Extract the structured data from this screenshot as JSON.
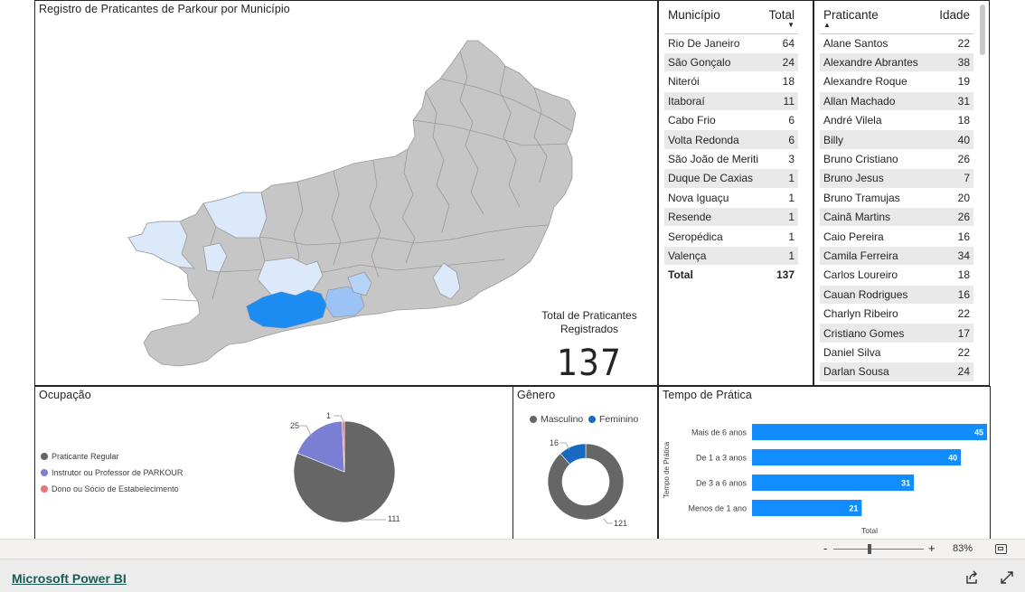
{
  "map": {
    "title": "Registro de Praticantes de Parkour por Município",
    "kpi_label": "Total de Praticantes Registrados",
    "kpi_value": "137"
  },
  "municipios": {
    "headers": [
      "Município",
      "Total"
    ],
    "rows": [
      [
        "Rio De Janeiro",
        "64"
      ],
      [
        "São Gonçalo",
        "24"
      ],
      [
        "Niterói",
        "18"
      ],
      [
        "Itaboraí",
        "11"
      ],
      [
        "Cabo Frio",
        "6"
      ],
      [
        "Volta Redonda",
        "6"
      ],
      [
        "São João de Meriti",
        "3"
      ],
      [
        "Duque De Caxias",
        "1"
      ],
      [
        "Nova Iguaçu",
        "1"
      ],
      [
        "Resende",
        "1"
      ],
      [
        "Seropédica",
        "1"
      ],
      [
        "Valença",
        "1"
      ]
    ],
    "total_label": "Total",
    "total_value": "137"
  },
  "praticantes": {
    "headers": [
      "Praticante",
      "Idade"
    ],
    "rows": [
      [
        "Alane Santos",
        "22"
      ],
      [
        "Alexandre Abrantes",
        "38"
      ],
      [
        "Alexandre Roque",
        "19"
      ],
      [
        "Allan Machado",
        "31"
      ],
      [
        "André Vilela",
        "18"
      ],
      [
        "Billy",
        "40"
      ],
      [
        "Bruno Cristiano",
        "26"
      ],
      [
        "Bruno Jesus",
        "7"
      ],
      [
        "Bruno Tramujas",
        "20"
      ],
      [
        "Cainã Martins",
        "26"
      ],
      [
        "Caio Pereira",
        "16"
      ],
      [
        "Camila Ferreira",
        "34"
      ],
      [
        "Carlos Loureiro",
        "18"
      ],
      [
        "Cauan Rodrigues",
        "16"
      ],
      [
        "Charlyn Ribeiro",
        "22"
      ],
      [
        "Cristiano Gomes",
        "17"
      ],
      [
        "Daniel Silva",
        "22"
      ],
      [
        "Darlan Sousa",
        "24"
      ]
    ]
  },
  "ocupacao": {
    "title": "Ocupação",
    "legend": [
      "Praticante Regular",
      "Instrutor ou Professor de PARKOUR",
      "Dono ou Sócio de Estabelecimento"
    ],
    "colors": [
      "#666666",
      "#7b7fd4",
      "#e8717a"
    ]
  },
  "genero": {
    "title": "Gênero",
    "legend": [
      "Masculino",
      "Feminino"
    ],
    "colors": [
      "#666666",
      "#1769c2"
    ]
  },
  "tempo": {
    "title": "Tempo de Prática",
    "axis_title": "Tempo de Prática",
    "xlabel": "Total",
    "color": "#118dff"
  },
  "chart_data": [
    {
      "type": "pie",
      "title": "Ocupação",
      "categories": [
        "Praticante Regular",
        "Instrutor ou Professor de PARKOUR",
        "Dono ou Sócio de Estabelecimento"
      ],
      "values": [
        111,
        25,
        1
      ]
    },
    {
      "type": "pie",
      "title": "Gênero",
      "categories": [
        "Masculino",
        "Feminino"
      ],
      "values": [
        121,
        16
      ]
    },
    {
      "type": "bar",
      "title": "Tempo de Prática",
      "categories": [
        "Mais de 6 anos",
        "De 1 a 3 anos",
        "De 3 a 6 anos",
        "Menos de 1 ano"
      ],
      "values": [
        45,
        40,
        31,
        21
      ],
      "xlabel": "Total",
      "ylabel": "Tempo de Prática"
    }
  ],
  "footer": {
    "zoom_minus": "-",
    "zoom_plus": "+",
    "zoom_level": "83%",
    "brand_link": "Microsoft Power BI"
  }
}
